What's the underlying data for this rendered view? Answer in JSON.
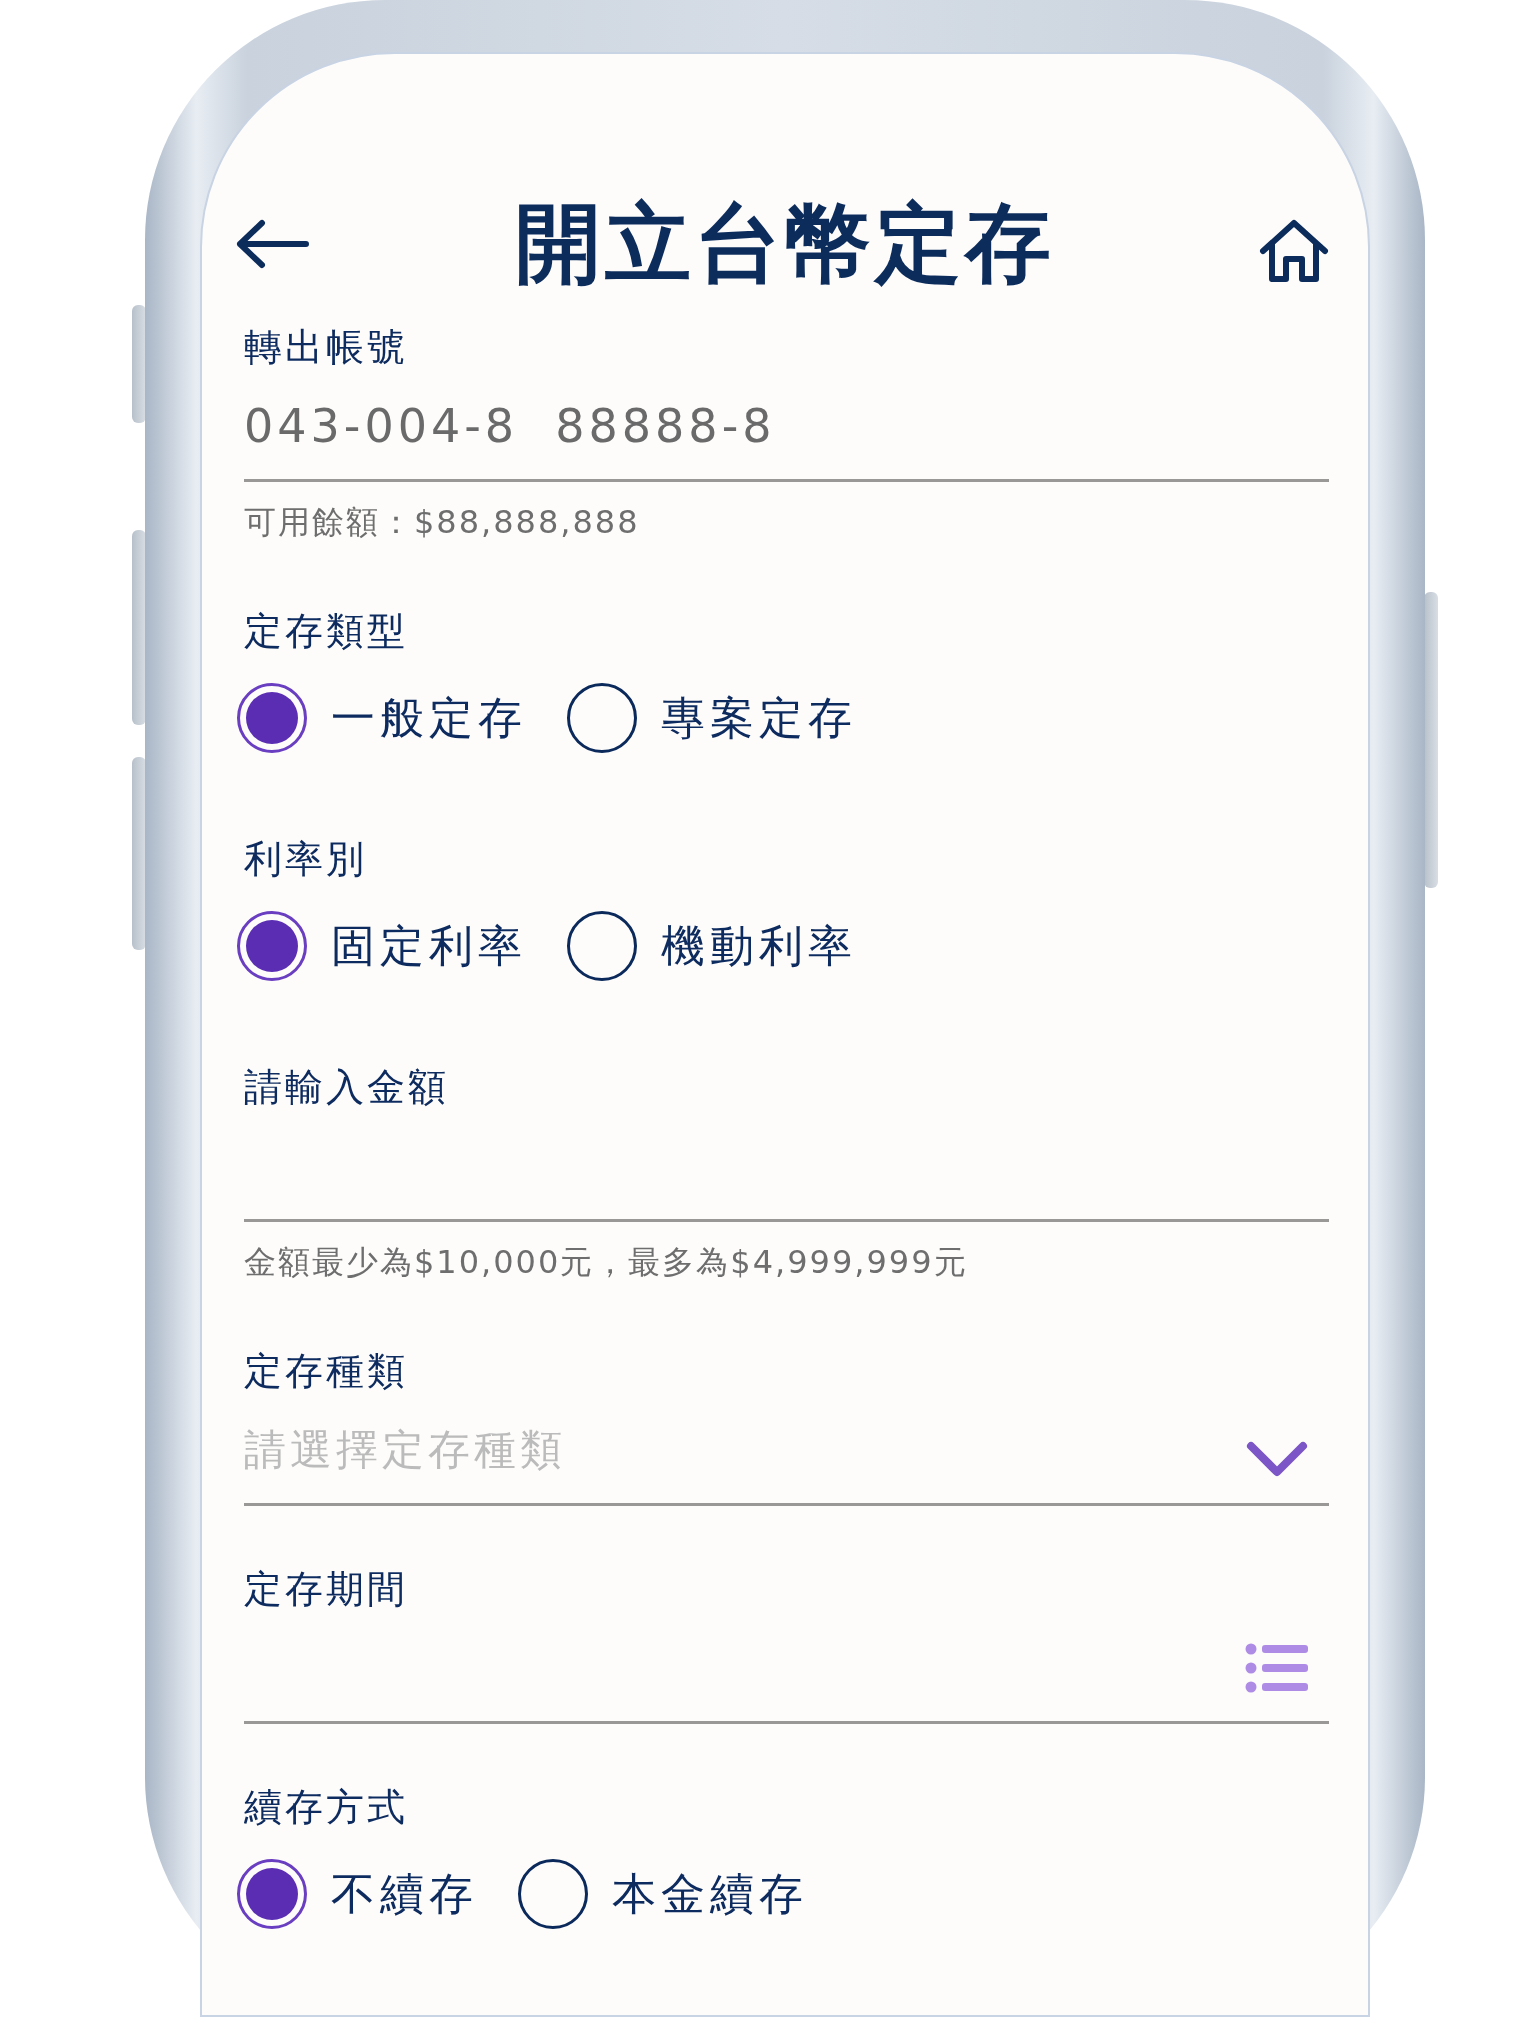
{
  "header": {
    "title": "開立台幣定存"
  },
  "fields": [
    {
      "kind": "text",
      "label": "轉出帳號",
      "value": "043-004-8  88888-8",
      "hint": "可用餘額：$88,888,888"
    },
    {
      "kind": "radio",
      "label": "定存類型",
      "options": [
        {
          "label": "一般定存",
          "selected": true
        },
        {
          "label": "專案定存",
          "selected": false
        }
      ]
    },
    {
      "kind": "radio",
      "label": "利率別",
      "options": [
        {
          "label": "固定利率",
          "selected": true
        },
        {
          "label": "機動利率",
          "selected": false
        }
      ]
    },
    {
      "kind": "input",
      "label": "請輸入金額",
      "hint": "金額最少為$10,000元，最多為$4,999,999元"
    },
    {
      "kind": "select",
      "label": "定存種類",
      "placeholder": "請選擇定存種類"
    },
    {
      "kind": "list",
      "label": "定存期間"
    },
    {
      "kind": "radio",
      "label": "續存方式",
      "options": [
        {
          "label": "不續存",
          "selected": true
        },
        {
          "label": "本金續存",
          "selected": false
        }
      ]
    }
  ]
}
